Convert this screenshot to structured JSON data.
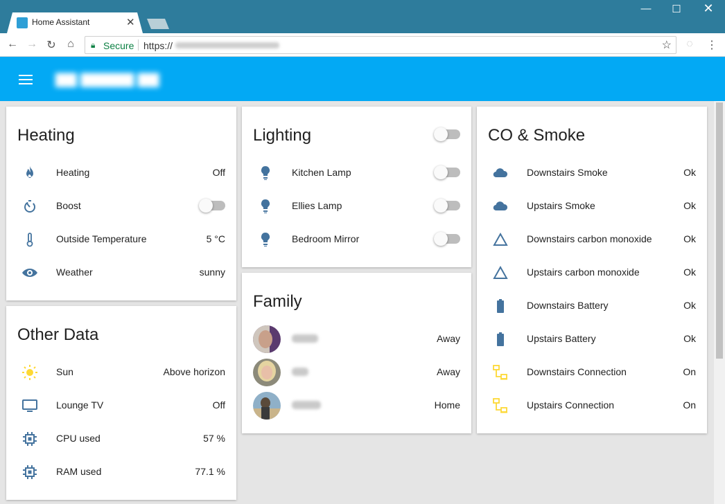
{
  "browser": {
    "tab_title": "Home Assistant",
    "url_secure_label": "Secure",
    "url_prefix": "https://"
  },
  "colors": {
    "header": "#03a9f4",
    "icon": "#44739e",
    "sun": "#fdd835",
    "connection": "#fdd835"
  },
  "cards": {
    "heating": {
      "title": "Heating",
      "rows": [
        {
          "icon": "fire-icon",
          "label": "Heating",
          "value": "Off"
        },
        {
          "icon": "timer-icon",
          "label": "Boost",
          "toggle": false
        },
        {
          "icon": "thermometer-icon",
          "label": "Outside Temperature",
          "value": "5 °C"
        },
        {
          "icon": "eye-icon",
          "label": "Weather",
          "value": "sunny"
        }
      ]
    },
    "other": {
      "title": "Other Data",
      "rows": [
        {
          "icon": "sun-icon",
          "label": "Sun",
          "value": "Above horizon"
        },
        {
          "icon": "monitor-icon",
          "label": "Lounge TV",
          "value": "Off"
        },
        {
          "icon": "chip-icon",
          "label": "CPU used",
          "value": "57 %"
        },
        {
          "icon": "chip-icon",
          "label": "RAM used",
          "value": "77.1 %"
        }
      ]
    },
    "lighting": {
      "title": "Lighting",
      "master_toggle": false,
      "rows": [
        {
          "icon": "bulb-icon",
          "label": "Kitchen Lamp",
          "toggle": false
        },
        {
          "icon": "bulb-icon",
          "label": "Ellies Lamp",
          "toggle": false
        },
        {
          "icon": "bulb-icon",
          "label": "Bedroom Mirror",
          "toggle": false
        }
      ]
    },
    "family": {
      "title": "Family",
      "rows": [
        {
          "icon": "avatar",
          "value": "Away"
        },
        {
          "icon": "avatar",
          "value": "Away"
        },
        {
          "icon": "avatar",
          "value": "Home"
        }
      ]
    },
    "co_smoke": {
      "title": "CO & Smoke",
      "rows": [
        {
          "icon": "cloud-icon",
          "label": "Downstairs Smoke",
          "value": "Ok"
        },
        {
          "icon": "cloud-icon",
          "label": "Upstairs Smoke",
          "value": "Ok"
        },
        {
          "icon": "triangle-icon",
          "label": "Downstairs carbon monoxide",
          "value": "Ok"
        },
        {
          "icon": "triangle-icon",
          "label": "Upstairs carbon monoxide",
          "value": "Ok"
        },
        {
          "icon": "battery-icon",
          "label": "Downstairs Battery",
          "value": "Ok"
        },
        {
          "icon": "battery-icon",
          "label": "Upstairs Battery",
          "value": "Ok"
        },
        {
          "icon": "network-icon",
          "label": "Downstairs Connection",
          "value": "On"
        },
        {
          "icon": "network-icon",
          "label": "Upstairs Connection",
          "value": "On"
        }
      ]
    }
  }
}
